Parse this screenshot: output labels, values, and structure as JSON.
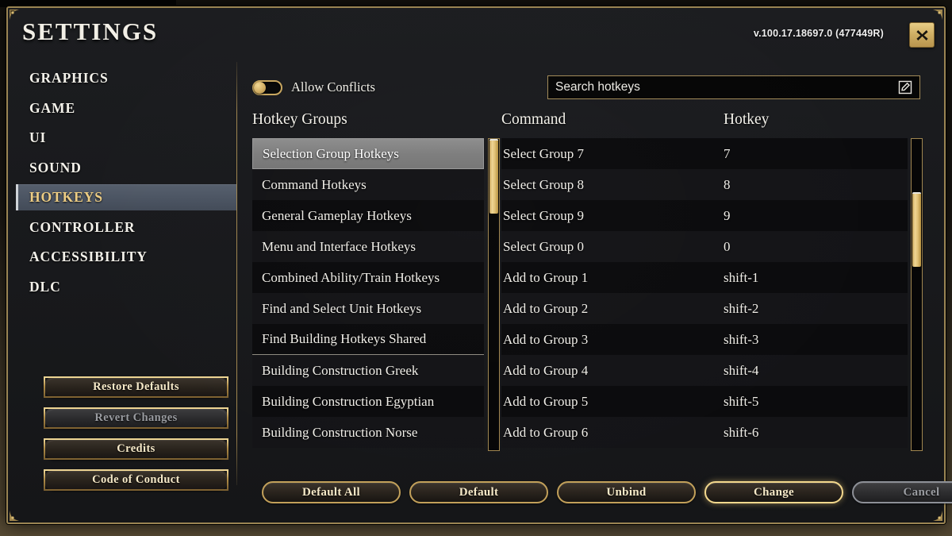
{
  "header": {
    "title": "SETTINGS",
    "version": "v.100.17.18697.0 (477449R)",
    "close_label": "close"
  },
  "sidebar": {
    "items": [
      {
        "label": "GRAPHICS",
        "active": false
      },
      {
        "label": "GAME",
        "active": false
      },
      {
        "label": "UI",
        "active": false
      },
      {
        "label": "SOUND",
        "active": false
      },
      {
        "label": "HOTKEYS",
        "active": true
      },
      {
        "label": "CONTROLLER",
        "active": false
      },
      {
        "label": "ACCESSIBILITY",
        "active": false
      },
      {
        "label": "DLC",
        "active": false
      }
    ],
    "buttons": [
      {
        "label": "Restore Defaults",
        "state": "normal"
      },
      {
        "label": "Revert Changes",
        "state": "disabled"
      },
      {
        "label": "Credits",
        "state": "normal"
      },
      {
        "label": "Code of Conduct",
        "state": "normal"
      }
    ]
  },
  "toolbar": {
    "allow_conflicts_label": "Allow Conflicts",
    "allow_conflicts_on": false,
    "search_placeholder": "Search hotkeys",
    "search_value": ""
  },
  "headings": {
    "groups": "Hotkey Groups",
    "command": "Command",
    "hotkey": "Hotkey"
  },
  "groups": {
    "items": [
      {
        "label": "Selection Group Hotkeys",
        "selected": true
      },
      {
        "label": "Command Hotkeys",
        "selected": false
      },
      {
        "label": "General Gameplay Hotkeys",
        "selected": false
      },
      {
        "label": "Menu and Interface Hotkeys",
        "selected": false
      },
      {
        "label": "Combined Ability/Train Hotkeys",
        "selected": false
      },
      {
        "label": "Find and Select Unit Hotkeys",
        "selected": false
      },
      {
        "label": "Find Building Hotkeys Shared",
        "selected": false,
        "separator_after": true
      },
      {
        "label": "Building Construction Greek",
        "selected": false
      },
      {
        "label": "Building Construction Egyptian",
        "selected": false
      },
      {
        "label": "Building Construction Norse",
        "selected": false
      }
    ],
    "scroll_thumb_top_pct": 0,
    "scroll_thumb_height_pct": 24
  },
  "table": {
    "rows": [
      {
        "command": "Select Group 7",
        "hotkey": "7"
      },
      {
        "command": "Select Group 8",
        "hotkey": "8"
      },
      {
        "command": "Select Group 9",
        "hotkey": "9"
      },
      {
        "command": "Select Group 0",
        "hotkey": "0"
      },
      {
        "command": "Add to Group 1",
        "hotkey": "shift-1"
      },
      {
        "command": "Add to Group 2",
        "hotkey": "shift-2"
      },
      {
        "command": "Add to Group 3",
        "hotkey": "shift-3"
      },
      {
        "command": "Add to Group 4",
        "hotkey": "shift-4"
      },
      {
        "command": "Add to Group 5",
        "hotkey": "shift-5"
      },
      {
        "command": "Add to Group 6",
        "hotkey": "shift-6"
      }
    ],
    "scroll_thumb_top_pct": 17,
    "scroll_thumb_height_pct": 24
  },
  "actions": [
    {
      "label": "Default All",
      "state": "normal"
    },
    {
      "label": "Default",
      "state": "normal"
    },
    {
      "label": "Unbind",
      "state": "normal"
    },
    {
      "label": "Change",
      "state": "bright"
    },
    {
      "label": "Cancel",
      "state": "disabled"
    }
  ],
  "colors": {
    "gold": "#c2a05a",
    "gold_bright": "#f0d694",
    "accent_text": "#edcd84",
    "panel_bg": "#1a1b1e",
    "selected_nav_bg": "#4b5462",
    "selected_row_bg": "#7e7e7e"
  }
}
